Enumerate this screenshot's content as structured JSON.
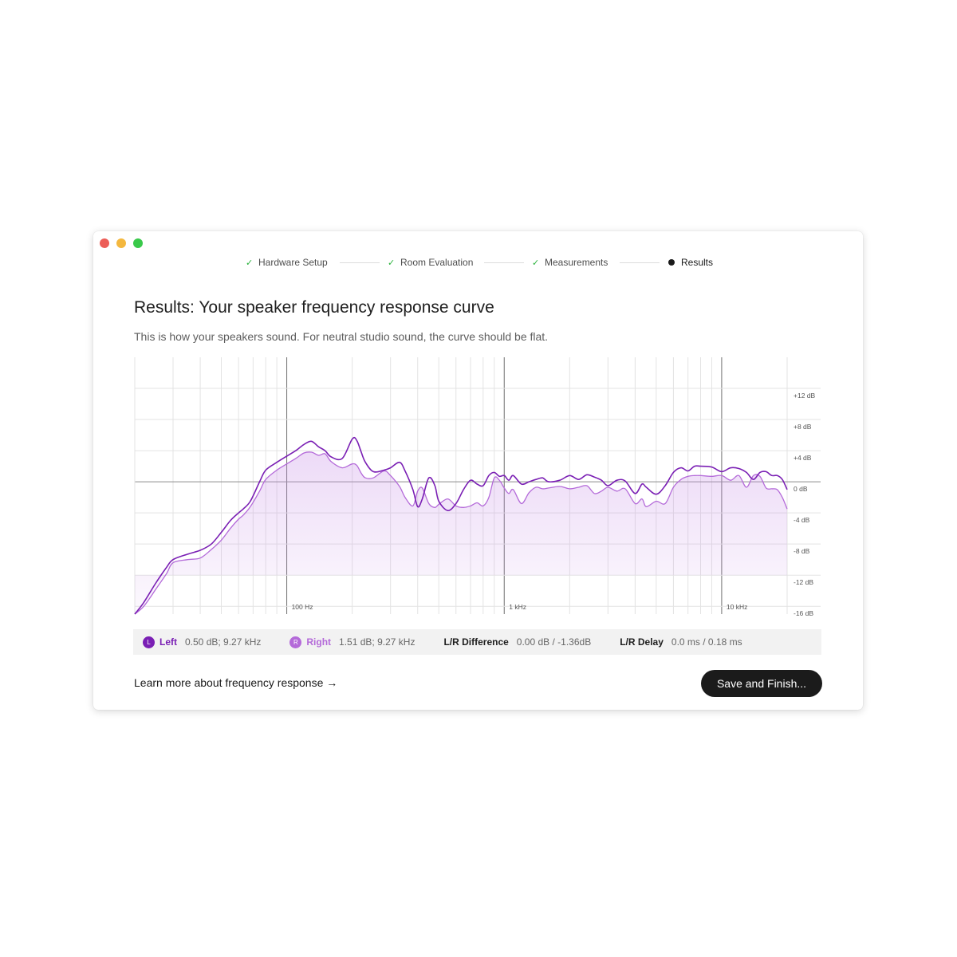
{
  "window": {
    "controls": [
      "close-icon",
      "minimize-icon",
      "maximize-icon"
    ]
  },
  "stepper": {
    "steps": [
      {
        "label": "Hardware Setup",
        "state": "done"
      },
      {
        "label": "Room Evaluation",
        "state": "done"
      },
      {
        "label": "Measurements",
        "state": "done"
      },
      {
        "label": "Results",
        "state": "active"
      }
    ],
    "check_glyph": "✓"
  },
  "main": {
    "title": "Results: Your speaker frequency response curve",
    "subtitle": "This is how your speakers sound. For neutral studio sound, the curve should be flat."
  },
  "chart_data": {
    "type": "line",
    "x_scale": "log",
    "x_unit": "Hz",
    "xlim": [
      20,
      20000
    ],
    "ylim": [
      -17,
      16
    ],
    "x_ticks": [
      {
        "value": 100,
        "label": "100 Hz"
      },
      {
        "value": 1000,
        "label": "1 kHz"
      },
      {
        "value": 10000,
        "label": "10 kHz"
      }
    ],
    "y_ticks": [
      {
        "value": 12,
        "label": "+12 dB"
      },
      {
        "value": 8,
        "label": "+8 dB"
      },
      {
        "value": 4,
        "label": "+4 dB"
      },
      {
        "value": 0,
        "label": "0 dB"
      },
      {
        "value": -4,
        "label": "-4 dB"
      },
      {
        "value": -8,
        "label": "-8 dB"
      },
      {
        "value": -12,
        "label": "-12 dB"
      },
      {
        "value": -16,
        "label": "-16 dB"
      }
    ],
    "grid": true,
    "series": [
      {
        "name": "Left",
        "color": "#7a1fb4",
        "x": [
          20,
          22,
          25,
          28,
          30,
          35,
          40,
          45,
          50,
          55,
          60,
          63,
          68,
          75,
          80,
          90,
          100,
          110,
          120,
          130,
          140,
          150,
          160,
          180,
          200,
          210,
          220,
          230,
          250,
          280,
          300,
          330,
          350,
          380,
          400,
          420,
          450,
          480,
          500,
          550,
          600,
          650,
          700,
          750,
          800,
          850,
          900,
          950,
          1000,
          1050,
          1100,
          1200,
          1300,
          1400,
          1500,
          1600,
          1800,
          2000,
          2200,
          2400,
          2600,
          2800,
          3000,
          3300,
          3600,
          4000,
          4300,
          4500,
          5000,
          5500,
          6000,
          6500,
          7000,
          7500,
          8000,
          9000,
          10000,
          11000,
          12000,
          13000,
          14000,
          15000,
          16000,
          17000,
          18000,
          19000,
          20000
        ],
        "values": [
          -17,
          -15.5,
          -13,
          -11,
          -10,
          -9.3,
          -8.8,
          -8,
          -6.5,
          -5,
          -4,
          -3.5,
          -2.5,
          0,
          1.5,
          2.5,
          3.3,
          4,
          4.8,
          5.2,
          4.5,
          4,
          3.2,
          3,
          5.5,
          5.3,
          3.8,
          2.5,
          1.3,
          1.5,
          1.8,
          2.5,
          1.4,
          -1,
          -3.2,
          -2.2,
          0.5,
          -0.5,
          -2.5,
          -3.7,
          -2.8,
          -1,
          0.2,
          -0.3,
          -0.5,
          0.8,
          1.2,
          0.7,
          0.8,
          0.2,
          0.8,
          -0.3,
          0,
          0.3,
          0.5,
          0,
          0.2,
          0.8,
          0.3,
          0.9,
          0.6,
          0.2,
          -0.5,
          0.2,
          0.1,
          -1.5,
          -0.3,
          -0.7,
          -1.6,
          -0.5,
          1.2,
          1.8,
          1.4,
          2,
          2,
          1.9,
          1.3,
          1.8,
          1.7,
          1.2,
          0.3,
          1.2,
          1.3,
          0.8,
          0.8,
          0.3,
          -1
        ]
      },
      {
        "name": "Right",
        "color": "#b46ad9",
        "x": [
          20,
          22,
          25,
          28,
          30,
          35,
          40,
          45,
          50,
          55,
          60,
          63,
          68,
          75,
          80,
          90,
          100,
          110,
          120,
          130,
          140,
          150,
          160,
          180,
          200,
          210,
          220,
          230,
          250,
          280,
          300,
          330,
          350,
          380,
          400,
          420,
          450,
          480,
          500,
          550,
          600,
          650,
          700,
          750,
          800,
          850,
          900,
          950,
          1000,
          1050,
          1100,
          1200,
          1300,
          1400,
          1500,
          1600,
          1800,
          2000,
          2200,
          2400,
          2600,
          2800,
          3000,
          3300,
          3600,
          4000,
          4300,
          4500,
          5000,
          5500,
          6000,
          6500,
          7000,
          7500,
          8000,
          9000,
          10000,
          11000,
          12000,
          13000,
          14000,
          15000,
          16000,
          17000,
          18000,
          19000,
          20000
        ],
        "values": [
          -17,
          -16,
          -13.8,
          -11.8,
          -10.4,
          -10,
          -9.8,
          -8.7,
          -7.5,
          -6,
          -4.8,
          -4.3,
          -3.2,
          -1.2,
          0.3,
          1.5,
          2.3,
          3,
          3.7,
          3.8,
          3.4,
          3.6,
          2.6,
          1.8,
          2.3,
          2.1,
          1.1,
          0.5,
          0.5,
          1.4,
          0.8,
          -0.6,
          -2,
          -3.1,
          -1.2,
          -0.8,
          -2.8,
          -3.3,
          -2.9,
          -2.2,
          -3.1,
          -3.3,
          -3.1,
          -2.7,
          -3.1,
          -2,
          0.5,
          0.2,
          -0.8,
          -1.5,
          -1,
          -2.8,
          -1.4,
          -0.7,
          -0.9,
          -0.8,
          -0.6,
          -0.9,
          -0.7,
          -0.5,
          -1.5,
          -1.2,
          -0.7,
          -1.2,
          -0.9,
          -2.8,
          -2.2,
          -3.2,
          -2.5,
          -2.8,
          -0.7,
          0.3,
          0.7,
          0.8,
          0.8,
          0.7,
          0.8,
          0.2,
          0.8,
          -0.7,
          0.8,
          0.7,
          -0.8,
          -0.9,
          -1,
          -2,
          -3.5
        ]
      }
    ]
  },
  "stats": {
    "left": {
      "badge": "L",
      "name": "Left",
      "value": "0.50 dB; 9.27 kHz"
    },
    "right": {
      "badge": "R",
      "name": "Right",
      "value": "1.51 dB; 9.27 kHz"
    },
    "diff": {
      "name": "L/R Difference",
      "value": "0.00 dB / -1.36dB"
    },
    "delay": {
      "name": "L/R Delay",
      "value": "0.0 ms / 0.18 ms"
    }
  },
  "footer": {
    "learn_more": "Learn more about frequency response →",
    "save_button": "Save and Finish..."
  },
  "colors": {
    "accent_left": "#7a1fb4",
    "accent_right": "#b46ad9",
    "check": "#2bb33d",
    "button_bg": "#1b1b1b"
  }
}
